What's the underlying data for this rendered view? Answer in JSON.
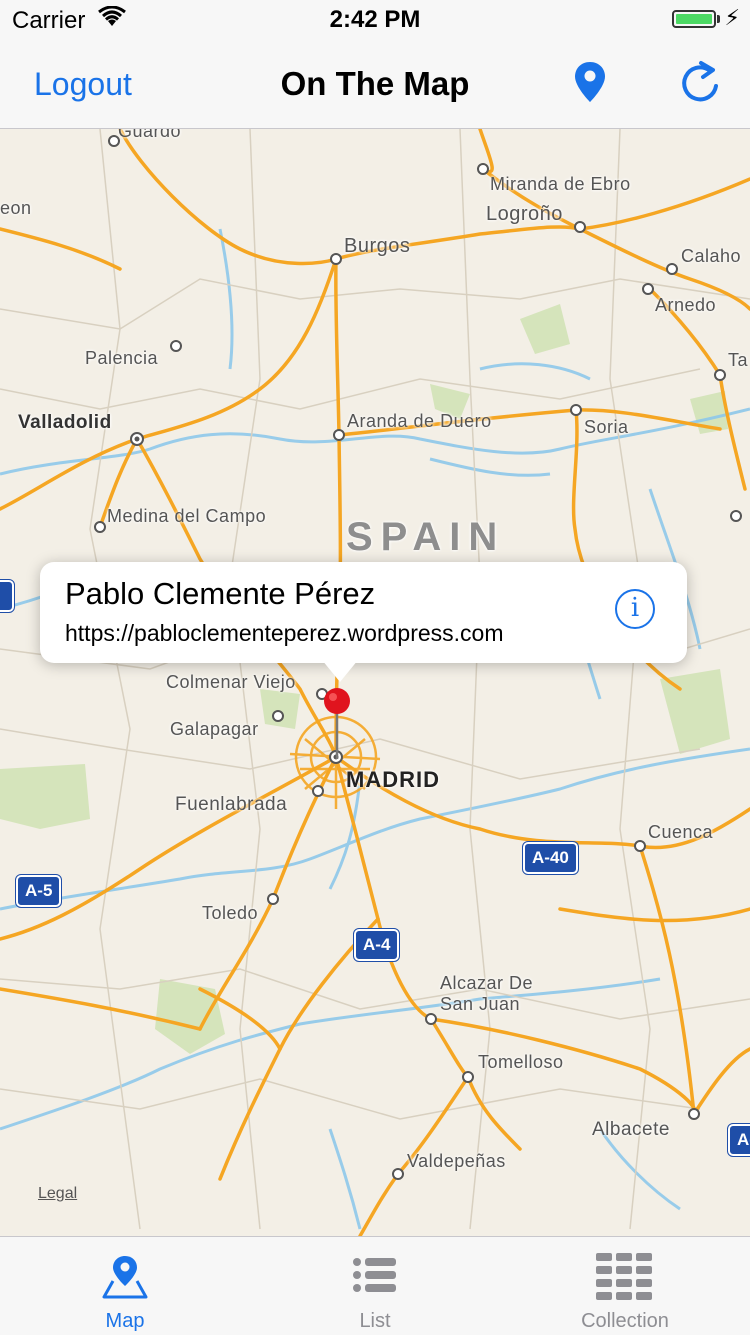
{
  "status_bar": {
    "carrier": "Carrier",
    "time": "2:42 PM"
  },
  "nav": {
    "left_button": "Logout",
    "title": "On The Map",
    "right_icons": [
      "pin-icon",
      "refresh-icon"
    ]
  },
  "map": {
    "country_label": "SPAIN",
    "capital_label": "MADRID",
    "cities": [
      {
        "name": "Miranda de Ebro"
      },
      {
        "name": "Logroño"
      },
      {
        "name": "Burgos"
      },
      {
        "name": "Calaho"
      },
      {
        "name": "Arnedo"
      },
      {
        "name": "Palencia"
      },
      {
        "name": "Valladolid"
      },
      {
        "name": "Aranda de Duero"
      },
      {
        "name": "Soria"
      },
      {
        "name": "Medina del Campo"
      },
      {
        "name": "Colmenar Viejo"
      },
      {
        "name": "Galapagar"
      },
      {
        "name": "Fuenlabrada"
      },
      {
        "name": "Cuenca"
      },
      {
        "name": "Toledo"
      },
      {
        "name": "Alcazar De"
      },
      {
        "name": "San Juan"
      },
      {
        "name": "Tomelloso"
      },
      {
        "name": "Albacete"
      },
      {
        "name": "Valdepeñas"
      },
      {
        "name": "Guardo"
      },
      {
        "name": "eon"
      },
      {
        "name": "Ta"
      }
    ],
    "highway_shields": [
      "A-40",
      "A-5",
      "A-4",
      "A-"
    ],
    "legal": "Legal",
    "callout": {
      "title": "Pablo Clemente Pérez",
      "subtitle": "https://pabloclementeperez.wordpress.com"
    }
  },
  "tabs": [
    {
      "label": "Map",
      "icon": "map-icon",
      "active": true
    },
    {
      "label": "List",
      "icon": "list-icon",
      "active": false
    },
    {
      "label": "Collection",
      "icon": "grid-icon",
      "active": false
    }
  ],
  "colors": {
    "accent": "#1a73e8",
    "road": "#f5a623",
    "water": "#7cc2e8",
    "park": "#c5dfa8",
    "land": "#f3efe6",
    "pin": "#e0141e"
  }
}
